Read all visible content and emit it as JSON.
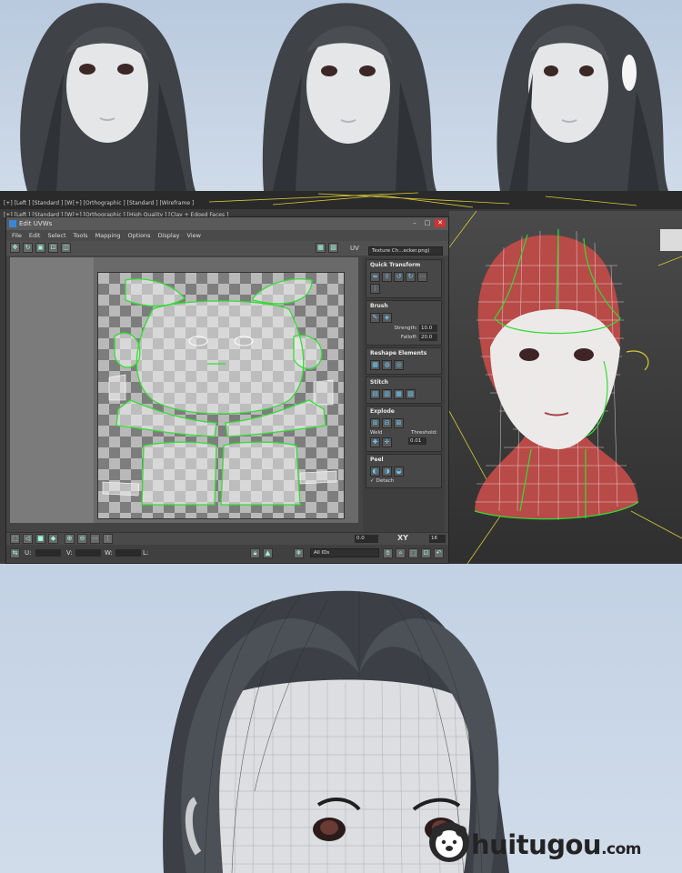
{
  "viewports": {
    "top_left_label": "[+] [Left ] [Standard ] [W",
    "top_mid_label": "[+] [Orthographic ] [Standard ] [Wireframe ]",
    "left_label": "[+] [Left ] [Standard ] [W",
    "mid_label": "[+] [Orthographic ] [High Quality ] [Clay + Edged Faces ]"
  },
  "uv_window": {
    "title": "Edit UVWs",
    "menu": [
      "File",
      "Edit",
      "Select",
      "Tools",
      "Mapping",
      "Options",
      "Display",
      "View"
    ],
    "uv_label": "UV",
    "texture_dropdown": "Texture Ch...ecker.png)",
    "panel": {
      "quick_transform": "Quick Transform",
      "brush": "Brush",
      "strength_label": "Strength:",
      "strength_value": "10.0",
      "falloff_label": "Falloff:",
      "falloff_value": "20.0",
      "reshape": "Reshape Elements",
      "stitch": "Stitch",
      "explode": "Explode",
      "weld_label": "Weld",
      "threshold_label": "Threshold:",
      "threshold_value": "0.01",
      "peel": "Peel",
      "detach_label": "Detach"
    },
    "status": {
      "u_label": "U:",
      "v_label": "V:",
      "w_label": "W:",
      "l_label": "L:",
      "ids_dropdown": "All IDs",
      "value_zero": "0.0",
      "xy_label": "XY",
      "grid_value": "16"
    }
  },
  "watermark": {
    "name": "huitugou",
    "domain_suffix": ".com"
  },
  "colors": {
    "sky": "#c6d3e3",
    "max_bg": "#3a3a3a",
    "uv_green": "#33dd33",
    "mesh_red": "#b84a48",
    "accent_blue": "#3b86d4"
  }
}
